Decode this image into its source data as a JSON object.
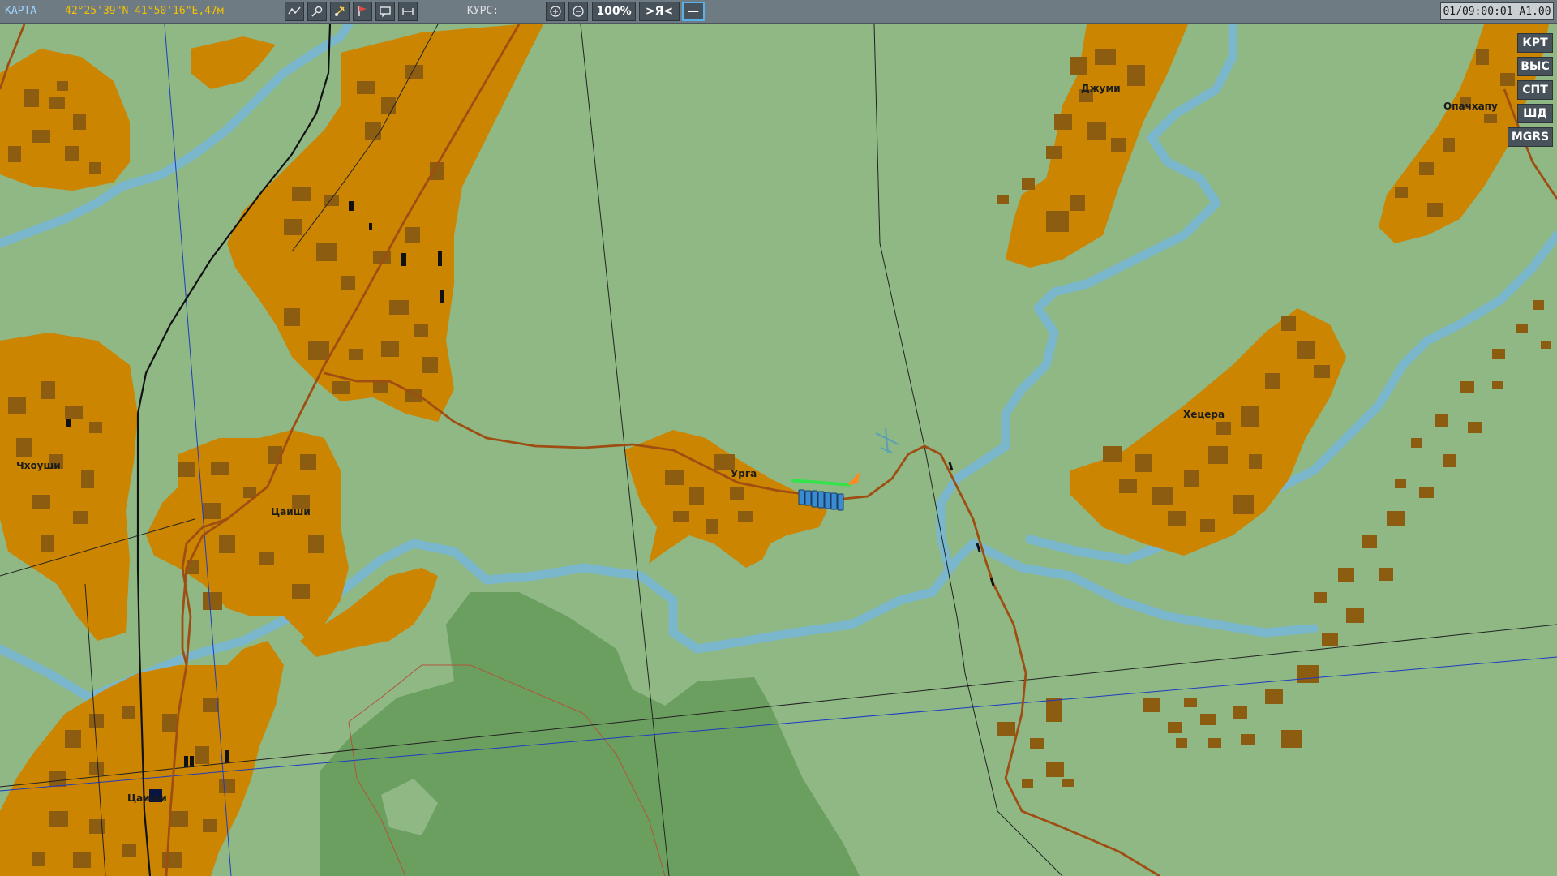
{
  "toolbar": {
    "mode_label": "КАРТА",
    "coordinates": "42°25'39\"N 41°50'16\"E,47м",
    "course_label": "КУРС:",
    "zoom_level": "100%",
    "center_label": ">Я<",
    "line_label": "—",
    "tool_icons": [
      "route-icon",
      "ruler-tool-icon",
      "target-icon",
      "flag-icon",
      "comment-icon",
      "distance-icon"
    ],
    "zoom_in_icon": "plus-circle-icon",
    "zoom_out_icon": "minus-circle-icon"
  },
  "time_display": "01/09:00:01 A1.00",
  "side_buttons": [
    "КРТ",
    "ВЫС",
    "СПТ",
    "ШД",
    "MGRS"
  ],
  "towns": [
    "Джуми",
    "Опачхапу",
    "Чхоуши",
    "Цаиши",
    "Урга",
    "Хецера",
    "Цаиши"
  ],
  "colors": {
    "terrain": "#8fb885",
    "forest": "#6b9f5f",
    "town_area": "#cc8500",
    "buildings": "#8c5c10",
    "river": "#7ab7cc",
    "road": "#9e4e12",
    "toolbar": "#6f7b83",
    "coords_text": "#f2c200",
    "mode_text": "#9fd4ff"
  }
}
